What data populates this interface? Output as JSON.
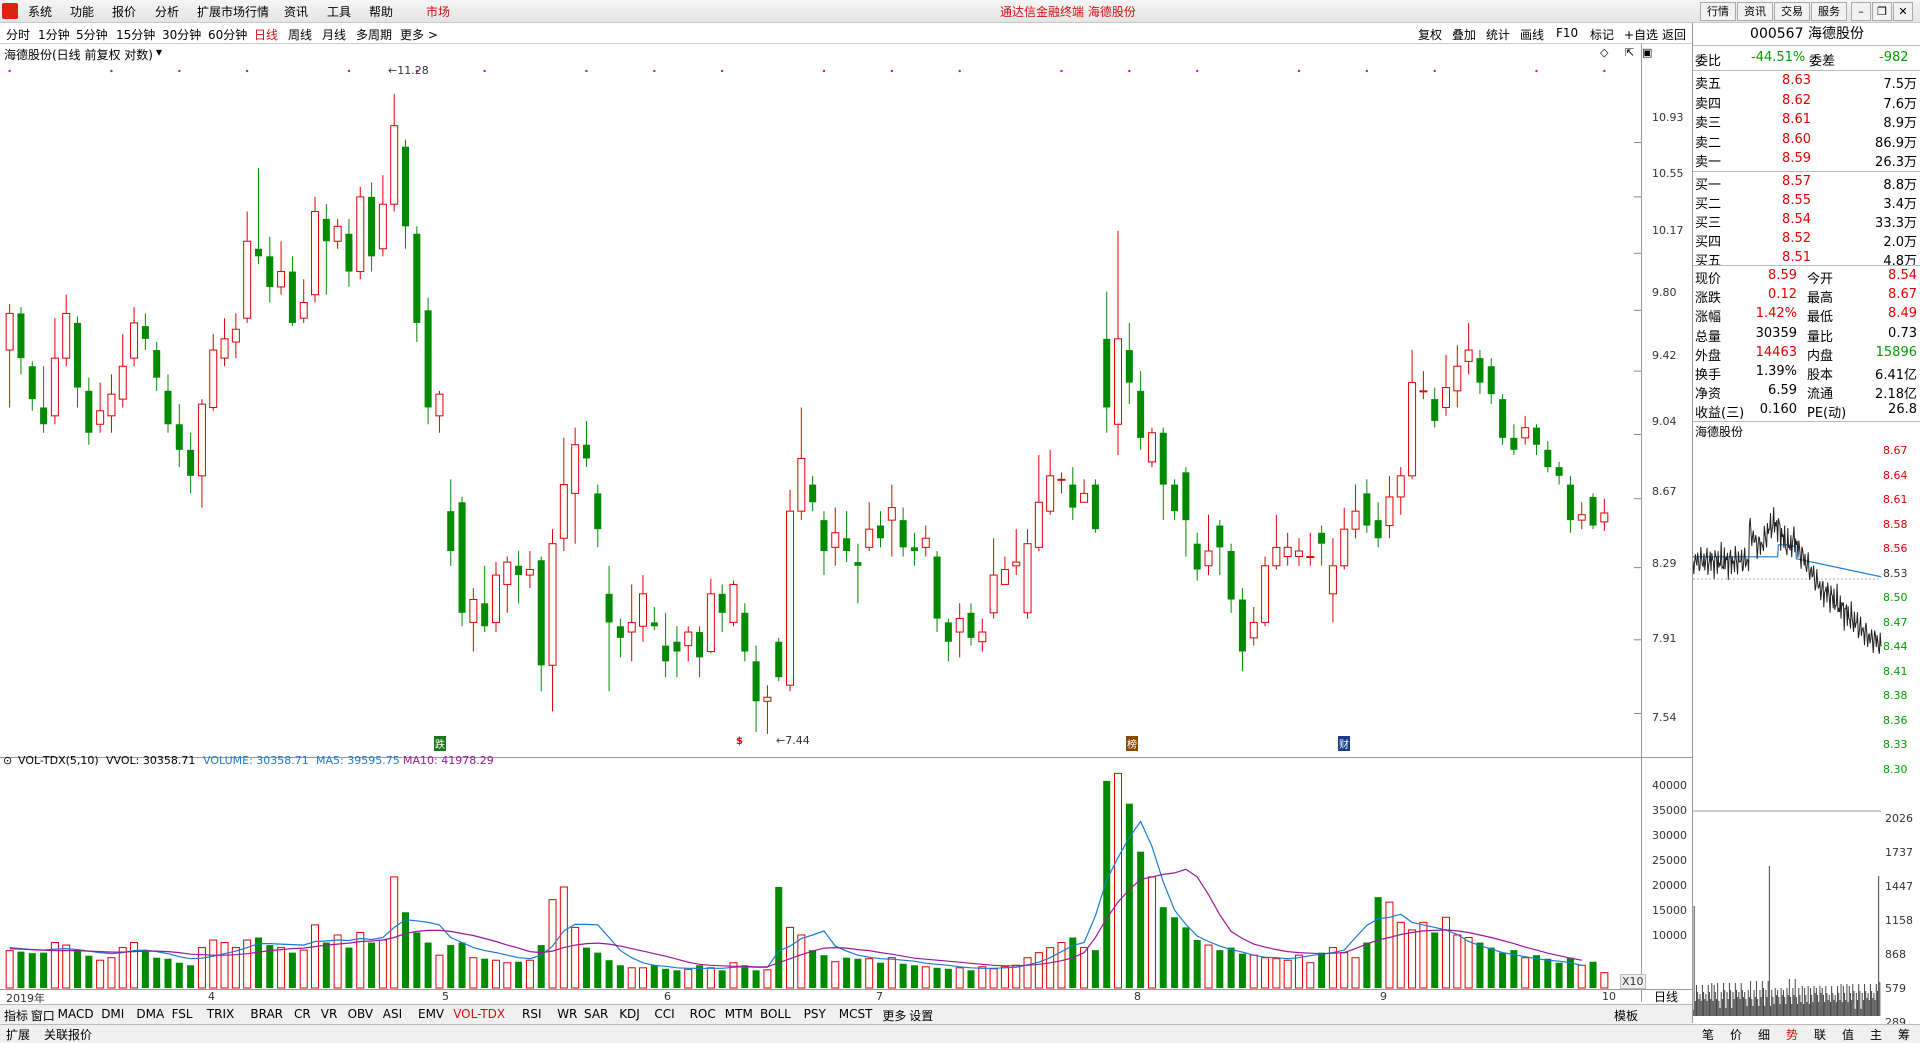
{
  "menu": [
    "系统",
    "功能",
    "报价",
    "分析",
    "扩展市场行情",
    "资讯",
    "工具",
    "帮助",
    "市场"
  ],
  "app_title": "通达信金融终端  海德股份",
  "top_buttons": [
    "行情",
    "资讯",
    "交易",
    "服务"
  ],
  "periods": [
    "分时",
    "1分钟",
    "5分钟",
    "15分钟",
    "30分钟",
    "60分钟",
    "日线",
    "周线",
    "月线",
    "多周期",
    "更多 >"
  ],
  "selected_period": "日线",
  "toolbar_right": [
    "复权",
    "叠加",
    "统计",
    "画线",
    "F10",
    "标记",
    "+自选",
    "返回"
  ],
  "chart_title": "海德股份(日线 前复权 对数)",
  "price_axis": [
    "10.93",
    "10.55",
    "10.17",
    "9.80",
    "9.42",
    "9.04",
    "8.67",
    "8.29",
    "7.91",
    "7.54"
  ],
  "price_high_label": "11.28",
  "price_low_label": "7.44",
  "month_labels": [
    "2019年",
    "4",
    "5",
    "6",
    "7",
    "8",
    "9",
    "10"
  ],
  "event_marks": [
    "跌",
    "$",
    "榜",
    "财"
  ],
  "vol_header": {
    "name": "VOL-TDX(5,10)",
    "vvol": "VVOL: 30358.71",
    "volume": "VOLUME: 30358.71",
    "ma5": "MA5: 39595.75",
    "ma10": "MA10: 41978.29"
  },
  "vol_axis": [
    "40000",
    "35000",
    "30000",
    "25000",
    "20000",
    "15000",
    "10000"
  ],
  "vol_unit": "X10",
  "period_tag": "日线",
  "stock_code": "000567",
  "stock_name": "海德股份",
  "weibi": {
    "label": "委比",
    "value": "-44.51%",
    "diff_label": "委差",
    "diff": "-982"
  },
  "asks": [
    {
      "label": "卖五",
      "price": "8.63",
      "vol": "7.5万"
    },
    {
      "label": "卖四",
      "price": "8.62",
      "vol": "7.6万"
    },
    {
      "label": "卖三",
      "price": "8.61",
      "vol": "8.9万"
    },
    {
      "label": "卖二",
      "price": "8.60",
      "vol": "86.9万"
    },
    {
      "label": "卖一",
      "price": "8.59",
      "vol": "26.3万"
    }
  ],
  "bids": [
    {
      "label": "买一",
      "price": "8.57",
      "vol": "8.8万"
    },
    {
      "label": "买二",
      "price": "8.55",
      "vol": "3.4万"
    },
    {
      "label": "买三",
      "price": "8.54",
      "vol": "33.3万"
    },
    {
      "label": "买四",
      "price": "8.52",
      "vol": "2.0万"
    },
    {
      "label": "买五",
      "price": "8.51",
      "vol": "4.8万"
    }
  ],
  "quote": [
    {
      "l1": "现价",
      "v1": "8.59",
      "l2": "今开",
      "v2": "8.54"
    },
    {
      "l1": "涨跌",
      "v1": "0.12",
      "l2": "最高",
      "v2": "8.67"
    },
    {
      "l1": "涨幅",
      "v1": "1.42%",
      "l2": "最低",
      "v2": "8.49"
    },
    {
      "l1": "总量",
      "v1": "30359",
      "l2": "量比",
      "v2": "0.73"
    },
    {
      "l1": "外盘",
      "v1": "14463",
      "l2": "内盘",
      "v2": "15896"
    },
    {
      "l1": "换手",
      "v1": "1.39%",
      "l2": "股本",
      "v2": "6.41亿"
    },
    {
      "l1": "净资",
      "v1": "6.59",
      "l2": "流通",
      "v2": "2.18亿"
    },
    {
      "l1": "收益(三)",
      "v1": "0.160",
      "l2": "PE(动)",
      "v2": "26.8"
    }
  ],
  "mini_title": "海德股份",
  "mini_price_axis": [
    "8.67",
    "8.64",
    "8.61",
    "8.58",
    "8.56",
    "8.53",
    "8.50",
    "8.47",
    "8.44",
    "8.41",
    "8.38",
    "8.36",
    "8.33",
    "8.30"
  ],
  "mini_vol_axis": [
    "2026",
    "1737",
    "1447",
    "1158",
    "868",
    "579",
    "289"
  ],
  "indicator_tabs": [
    "指标",
    "窗口",
    "MACD",
    "DMI",
    "DMA",
    "FSL",
    "TRIX",
    "BRAR",
    "CR",
    "VR",
    "OBV",
    "ASI",
    "EMV",
    "VOL-TDX",
    "RSI",
    "WR",
    "SAR",
    "KDJ",
    "CCI",
    "ROC",
    "MTM",
    "BOLL",
    "PSY",
    "MCST",
    "更多",
    "设置"
  ],
  "selected_indicator": "VOL-TDX",
  "template_label": "模板",
  "status_items": [
    "扩展",
    "关联报价"
  ],
  "right_tabs": [
    "笔",
    "价",
    "细",
    "势",
    "联",
    "值",
    "主",
    "筹"
  ],
  "colors": {
    "up": "#e00000",
    "down": "#008a00",
    "accent": "#d01010"
  },
  "chart_data": {
    "type": "candlestick",
    "candles": [
      [
        9.55,
        9.78,
        9.84,
        9.2
      ],
      [
        9.78,
        9.5,
        9.82,
        9.4
      ],
      [
        9.45,
        9.25,
        9.48,
        9.18
      ],
      [
        9.2,
        9.1,
        9.45,
        9.05
      ],
      [
        9.15,
        9.5,
        9.75,
        9.1
      ],
      [
        9.5,
        9.78,
        9.9,
        9.45
      ],
      [
        9.72,
        9.32,
        9.76,
        9.2
      ],
      [
        9.3,
        9.05,
        9.38,
        8.98
      ],
      [
        9.1,
        9.18,
        9.35,
        9.05
      ],
      [
        9.15,
        9.28,
        9.4,
        9.05
      ],
      [
        9.25,
        9.45,
        9.65,
        9.2
      ],
      [
        9.5,
        9.72,
        9.82,
        9.45
      ],
      [
        9.7,
        9.62,
        9.78,
        9.55
      ],
      [
        9.55,
        9.38,
        9.6,
        9.3
      ],
      [
        9.3,
        9.1,
        9.4,
        9.05
      ],
      [
        9.1,
        8.95,
        9.22,
        8.85
      ],
      [
        8.95,
        8.8,
        9.05,
        8.7
      ],
      [
        8.8,
        9.22,
        9.25,
        8.62
      ],
      [
        9.2,
        9.55,
        9.65,
        9.18
      ],
      [
        9.5,
        9.62,
        9.75,
        9.45
      ],
      [
        9.6,
        9.68,
        9.78,
        9.5
      ],
      [
        9.75,
        10.25,
        10.45,
        9.72
      ],
      [
        10.2,
        10.15,
        10.75,
        10.1
      ],
      [
        10.15,
        9.95,
        10.28,
        9.85
      ],
      [
        9.95,
        10.05,
        10.25,
        9.9
      ],
      [
        10.05,
        9.72,
        10.15,
        9.7
      ],
      [
        9.75,
        9.85,
        10.0,
        9.72
      ],
      [
        9.9,
        10.45,
        10.55,
        9.85
      ],
      [
        10.4,
        10.25,
        10.5,
        9.9
      ],
      [
        10.25,
        10.35,
        10.4,
        10.2
      ],
      [
        10.3,
        10.05,
        10.4,
        9.95
      ],
      [
        10.05,
        10.55,
        10.62,
        10.0
      ],
      [
        10.55,
        10.15,
        10.65,
        10.05
      ],
      [
        10.2,
        10.5,
        10.7,
        10.15
      ],
      [
        10.5,
        11.05,
        11.28,
        10.45
      ],
      [
        10.9,
        10.35,
        10.95,
        10.2
      ],
      [
        10.3,
        9.72,
        10.35,
        9.6
      ],
      [
        9.8,
        9.2,
        9.88,
        9.1
      ],
      [
        9.15,
        9.28,
        9.3,
        9.05
      ],
      [
        8.6,
        8.38,
        8.78,
        8.3
      ],
      [
        8.65,
        8.05,
        8.68,
        7.98
      ],
      [
        8.0,
        8.12,
        8.18,
        7.85
      ],
      [
        8.1,
        7.98,
        8.3,
        7.95
      ],
      [
        8.0,
        8.25,
        8.32,
        7.95
      ],
      [
        8.2,
        8.32,
        8.35,
        8.05
      ],
      [
        8.3,
        8.25,
        8.38,
        8.1
      ],
      [
        8.25,
        8.28,
        8.38,
        8.18
      ],
      [
        8.33,
        7.78,
        8.35,
        7.65
      ],
      [
        7.78,
        8.42,
        8.5,
        7.55
      ],
      [
        8.45,
        8.75,
        9.02,
        8.38
      ],
      [
        8.7,
        8.98,
        9.08,
        8.42
      ],
      [
        8.98,
        8.9,
        9.12,
        8.85
      ],
      [
        8.7,
        8.5,
        8.75,
        8.4
      ],
      [
        8.15,
        8.0,
        8.3,
        7.65
      ],
      [
        7.98,
        7.92,
        8.02,
        7.82
      ],
      [
        7.95,
        8.0,
        8.2,
        7.8
      ],
      [
        7.98,
        8.15,
        8.25,
        7.9
      ],
      [
        8.0,
        7.98,
        8.08,
        7.96
      ],
      [
        7.88,
        7.8,
        8.05,
        7.72
      ],
      [
        7.9,
        7.85,
        7.98,
        7.72
      ],
      [
        7.88,
        7.95,
        7.98,
        7.8
      ],
      [
        7.95,
        7.82,
        7.98,
        7.72
      ],
      [
        7.85,
        8.15,
        8.23,
        7.84
      ],
      [
        8.15,
        8.05,
        8.2,
        7.95
      ],
      [
        8.0,
        8.2,
        8.22,
        7.98
      ],
      [
        8.05,
        7.85,
        8.1,
        7.8
      ],
      [
        7.8,
        7.6,
        7.88,
        7.45
      ],
      [
        7.6,
        7.62,
        7.68,
        7.44
      ],
      [
        7.9,
        7.72,
        7.92,
        7.7
      ],
      [
        7.68,
        8.6,
        8.72,
        7.65
      ],
      [
        8.6,
        8.9,
        9.2,
        8.55
      ],
      [
        8.75,
        8.65,
        8.8,
        8.6
      ],
      [
        8.55,
        8.38,
        8.6,
        8.25
      ],
      [
        8.4,
        8.48,
        8.62,
        8.3
      ],
      [
        8.45,
        8.38,
        8.6,
        8.32
      ],
      [
        8.32,
        8.3,
        8.42,
        8.1
      ],
      [
        8.4,
        8.5,
        8.65,
        8.38
      ],
      [
        8.52,
        8.45,
        8.6,
        8.4
      ],
      [
        8.55,
        8.62,
        8.75,
        8.35
      ],
      [
        8.55,
        8.4,
        8.62,
        8.35
      ],
      [
        8.4,
        8.38,
        8.48,
        8.3
      ],
      [
        8.4,
        8.45,
        8.52,
        8.35
      ],
      [
        8.35,
        8.02,
        8.38,
        7.95
      ],
      [
        8.0,
        7.9,
        8.02,
        7.8
      ],
      [
        7.95,
        8.02,
        8.1,
        7.82
      ],
      [
        8.05,
        7.92,
        8.1,
        7.88
      ],
      [
        7.9,
        7.95,
        8.02,
        7.85
      ],
      [
        8.05,
        8.25,
        8.45,
        8.02
      ],
      [
        8.2,
        8.28,
        8.35,
        8.2
      ],
      [
        8.3,
        8.32,
        8.5,
        8.25
      ],
      [
        8.05,
        8.42,
        8.5,
        8.02
      ],
      [
        8.4,
        8.65,
        8.92,
        8.38
      ],
      [
        8.6,
        8.8,
        8.95,
        8.58
      ],
      [
        8.78,
        8.78,
        8.82,
        8.7
      ],
      [
        8.75,
        8.62,
        8.85,
        8.55
      ],
      [
        8.65,
        8.7,
        8.78,
        8.65
      ],
      [
        8.75,
        8.5,
        8.78,
        8.48
      ],
      [
        9.62,
        9.2,
        9.92,
        9.05
      ],
      [
        9.1,
        9.62,
        10.32,
        8.92
      ],
      [
        9.55,
        9.35,
        9.72,
        9.22
      ],
      [
        9.3,
        9.02,
        9.42,
        8.95
      ],
      [
        8.88,
        9.05,
        9.08,
        8.85
      ],
      [
        9.05,
        8.75,
        9.08,
        8.55
      ],
      [
        8.75,
        8.6,
        8.78,
        8.55
      ],
      [
        8.82,
        8.55,
        8.85,
        8.35
      ],
      [
        8.42,
        8.28,
        8.48,
        8.22
      ],
      [
        8.3,
        8.38,
        8.58,
        8.25
      ],
      [
        8.52,
        8.4,
        8.55,
        8.25
      ],
      [
        8.38,
        8.12,
        8.42,
        8.05
      ],
      [
        8.12,
        7.85,
        8.18,
        7.75
      ],
      [
        7.92,
        8.0,
        8.08,
        7.88
      ],
      [
        8.0,
        8.3,
        8.35,
        7.98
      ],
      [
        8.3,
        8.4,
        8.58,
        8.28
      ],
      [
        8.35,
        8.4,
        8.48,
        8.3
      ],
      [
        8.35,
        8.38,
        8.45,
        8.3
      ],
      [
        8.35,
        8.35,
        8.48,
        8.3
      ],
      [
        8.48,
        8.42,
        8.52,
        8.3
      ],
      [
        8.15,
        8.3,
        8.45,
        8.0
      ],
      [
        8.3,
        8.5,
        8.62,
        8.28
      ],
      [
        8.5,
        8.6,
        8.75,
        8.45
      ],
      [
        8.7,
        8.52,
        8.78,
        8.48
      ],
      [
        8.55,
        8.45,
        8.65,
        8.4
      ],
      [
        8.52,
        8.68,
        8.8,
        8.45
      ],
      [
        8.68,
        8.8,
        8.85,
        8.58
      ],
      [
        8.8,
        9.35,
        9.55,
        8.78
      ],
      [
        9.3,
        9.3,
        9.42,
        9.25
      ],
      [
        9.25,
        9.12,
        9.32,
        9.08
      ],
      [
        9.2,
        9.32,
        9.52,
        9.15
      ],
      [
        9.3,
        9.45,
        9.58,
        9.2
      ],
      [
        9.48,
        9.55,
        9.72,
        9.4
      ],
      [
        9.5,
        9.35,
        9.55,
        9.28
      ],
      [
        9.45,
        9.28,
        9.5,
        9.22
      ],
      [
        9.25,
        9.02,
        9.28,
        8.98
      ],
      [
        9.02,
        8.95,
        9.1,
        8.92
      ],
      [
        9.02,
        9.08,
        9.15,
        8.98
      ],
      [
        9.08,
        8.98,
        9.1,
        8.92
      ],
      [
        8.95,
        8.85,
        9.0,
        8.82
      ],
      [
        8.85,
        8.8,
        8.88,
        8.75
      ],
      [
        8.75,
        8.55,
        8.8,
        8.48
      ],
      [
        8.55,
        8.58,
        8.65,
        8.5
      ],
      [
        8.68,
        8.52,
        8.7,
        8.5
      ],
      [
        8.54,
        8.59,
        8.67,
        8.49
      ]
    ],
    "volumes": [
      7400,
      7200,
      6900,
      7000,
      9000,
      8500,
      7500,
      6400,
      5500,
      6000,
      8000,
      9000,
      7500,
      6000,
      5800,
      5000,
      4500,
      8000,
      9500,
      9000,
      8000,
      9500,
      10000,
      8500,
      8000,
      7000,
      7500,
      12500,
      9000,
      10500,
      8000,
      11000,
      9000,
      9500,
      22000,
      15000,
      11000,
      9000,
      6500,
      8500,
      9000,
      6000,
      5800,
      5500,
      5000,
      5200,
      5500,
      8500,
      17500,
      20000,
      12000,
      8000,
      7000,
      5500,
      4500,
      4000,
      4000,
      4500,
      3800,
      3500,
      3700,
      4500,
      4000,
      3500,
      5000,
      4500,
      3500,
      3600,
      20000,
      12000,
      10500,
      7500,
      6500,
      5200,
      6000,
      5800,
      5800,
      5000,
      6000,
      4800,
      4500,
      4200,
      4000,
      3800,
      4000,
      3500,
      4200,
      3800,
      4200,
      4500,
      6000,
      7000,
      8000,
      9000,
      10000,
      8000,
      7500,
      41000,
      42500,
      36500,
      27000,
      22000,
      16000,
      14000,
      12000,
      9500,
      8500,
      7500,
      8000,
      6800,
      6500,
      6000,
      5800,
      5500,
      6500,
      5000,
      7000,
      8000,
      7000,
      6000,
      9000,
      18000,
      17000,
      13000,
      11500,
      13000,
      11000,
      14000,
      10500,
      10000,
      9000,
      8000,
      7000,
      7500,
      6000,
      6500,
      5800,
      5000,
      6000,
      4500,
      5200,
      3036
    ],
    "vol_ma5": [
      8000,
      7800,
      7600,
      7500,
      7700,
      7800,
      7600,
      7300,
      7000,
      6800,
      7000,
      7400,
      7500,
      7200,
      6800,
      6200,
      5800,
      5900,
      6300,
      6800,
      7300,
      8000,
      8800,
      8800,
      8700,
      8600,
      8500,
      9200,
      9300,
      9500,
      9400,
      9800,
      9600,
      10000,
      12000,
      13500,
      13300,
      13000,
      12500,
      10000,
      9000,
      8000,
      7400,
      7000,
      6500,
      6000,
      5800,
      6500,
      8300,
      11300,
      12600,
      12600,
      12500,
      10000,
      7400,
      6000,
      5000,
      4500,
      4300,
      4000,
      3900,
      3900,
      3900,
      3900,
      4100,
      4200,
      4100,
      4100,
      7300,
      8300,
      9800,
      10500,
      11300,
      8300,
      7300,
      6500,
      6100,
      5800,
      5700,
      5500,
      5300,
      4900,
      4700,
      4500,
      4200,
      4000,
      3900,
      3900,
      4000,
      4100,
      4600,
      5100,
      6000,
      7200,
      8400,
      9000,
      14300,
      21400,
      25800,
      29800,
      33000,
      28000,
      21000,
      15400,
      12600,
      10300,
      9200,
      8300,
      7600,
      7100,
      6500,
      6100,
      6000,
      5800,
      6000,
      6400,
      6700,
      7000,
      7500,
      10000,
      12400,
      13700,
      14000,
      14600,
      13000,
      12500,
      12000,
      11500,
      10600,
      9200,
      8400,
      7700,
      7000,
      6600,
      6200,
      5800,
      5500,
      5300,
      5000,
      4500
    ],
    "vol_ma10": [
      7800,
      7700,
      7600,
      7500,
      7400,
      7400,
      7400,
      7300,
      7200,
      7100,
      7100,
      7200,
      7300,
      7300,
      7200,
      7000,
      6700,
      6600,
      6500,
      6500,
      6600,
      6800,
      7100,
      7400,
      7600,
      7800,
      7900,
      8200,
      8500,
      8700,
      8900,
      9200,
      9300,
      9500,
      10000,
      10800,
      11200,
      11400,
      11400,
      11200,
      10800,
      10400,
      9800,
      9200,
      8500,
      7900,
      7200,
      7000,
      7300,
      8000,
      8500,
      8800,
      8900,
      8700,
      8300,
      7800,
      7300,
      6800,
      6300,
      5700,
      5100,
      4700,
      4500,
      4400,
      4300,
      4300,
      4200,
      4200,
      5000,
      5800,
      6600,
      7300,
      7900,
      8000,
      7900,
      7600,
      7400,
      7000,
      6700,
      6300,
      5900,
      5700,
      5500,
      5300,
      5100,
      4900,
      4700,
      4500,
      4400,
      4400,
      4500,
      4700,
      5000,
      5400,
      6000,
      7000,
      10000,
      13800,
      17000,
      19500,
      21500,
      22000,
      22500,
      22800,
      23500,
      22000,
      18500,
      14500,
      11200,
      9800,
      8700,
      8100,
      7600,
      7200,
      7000,
      6900,
      6800,
      6900,
      7000,
      7800,
      8700,
      9500,
      10000,
      10600,
      11000,
      11300,
      11400,
      11500,
      11300,
      11000,
      10500,
      10000,
      9400,
      8800,
      8100,
      7500,
      6900,
      6400,
      5900,
      5500
    ]
  }
}
